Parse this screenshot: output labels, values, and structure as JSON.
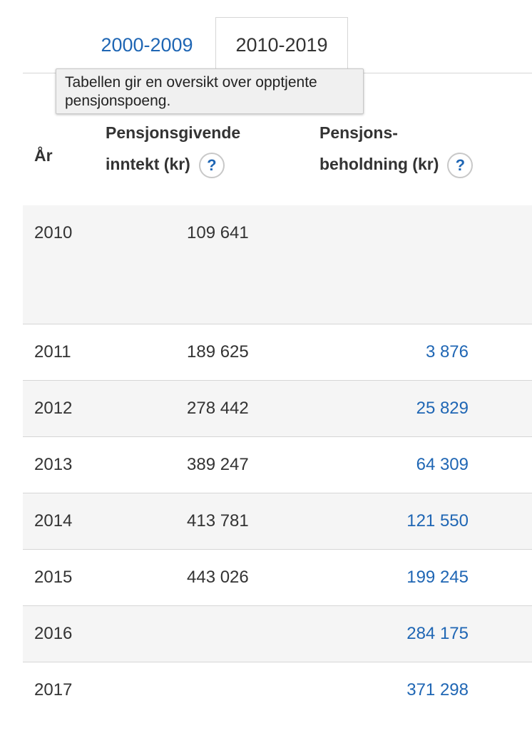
{
  "tabs": [
    {
      "label": "2000-2009",
      "active": false
    },
    {
      "label": "2010-2019",
      "active": true
    }
  ],
  "tooltip": {
    "text": "Tabellen gir en oversikt over opptjente pensjonspoeng."
  },
  "table": {
    "headers": {
      "year": "År",
      "income_line1": "Pensjonsgivende",
      "income_line2": "inntekt (kr)",
      "pension_line1": "Pensjons-",
      "pension_line2": "beholdning (kr)",
      "help": "?"
    },
    "rows": [
      {
        "year": "2010",
        "income": "109 641",
        "pension": ""
      },
      {
        "year": "2011",
        "income": "189 625",
        "pension": "3 876"
      },
      {
        "year": "2012",
        "income": "278 442",
        "pension": "25 829"
      },
      {
        "year": "2013",
        "income": "389 247",
        "pension": "64 309"
      },
      {
        "year": "2014",
        "income": "413 781",
        "pension": "121 550"
      },
      {
        "year": "2015",
        "income": "443 026",
        "pension": "199 245"
      },
      {
        "year": "2016",
        "income": "",
        "pension": "284 175"
      },
      {
        "year": "2017",
        "income": "",
        "pension": "371 298"
      }
    ]
  },
  "colors": {
    "link": "#1f66b4",
    "text": "#333333",
    "stripe": "#f5f5f5",
    "border": "#d6d6d6"
  }
}
